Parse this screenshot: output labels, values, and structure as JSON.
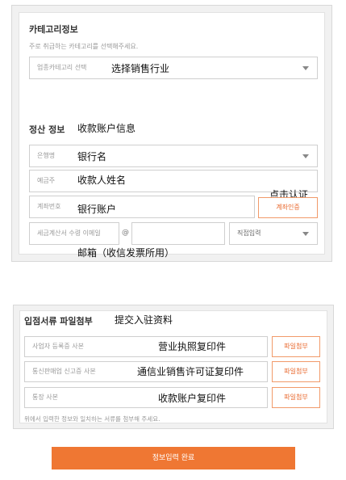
{
  "category": {
    "title": "카테고리정보",
    "hint": "주로 취급하는 카테고리를 선택해주세요.",
    "select_placeholder": "업종카테고리 선택",
    "select_note": "选择销售行业"
  },
  "settlement": {
    "title": "정산 정보",
    "title_note": "收款账户信息",
    "bank_placeholder": "은행명",
    "bank_note": "银行名",
    "holder_placeholder": "예금주",
    "holder_note": "收款人姓名",
    "account_placeholder": "계좌번호",
    "account_note": "银行账户",
    "verify_button": "계좌인증",
    "verify_note": "点击认证",
    "email_placeholder": "세금계산서 수령 이메일",
    "email_at": "@",
    "email_domain_select": "직접입력",
    "email_note": "邮箱（收信发票所用）"
  },
  "documents": {
    "title": "입점서류 파일첨부",
    "title_note": "提交入驻资料",
    "rows": [
      {
        "placeholder": "사업자 등록증 사본",
        "note": "营业执照复印件",
        "button": "파일첨부"
      },
      {
        "placeholder": "통신판매업 신고증 사본",
        "note": "通信业销售许可证复印件",
        "button": "파일첨부"
      },
      {
        "placeholder": "통장 사본",
        "note": "收款账户复印件",
        "button": "파일첨부"
      }
    ],
    "footnote": "위에서 입력한 정보와 일치하는 서류를 첨부해 주세요."
  },
  "submit_label": "정보입력 완료"
}
